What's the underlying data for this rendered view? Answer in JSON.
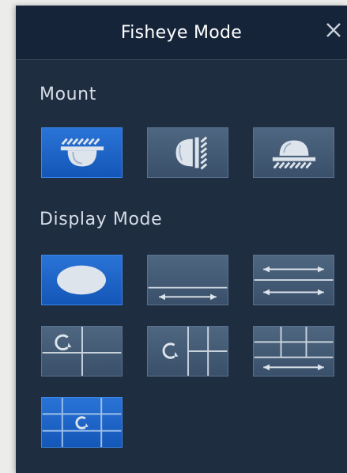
{
  "dialog": {
    "title": "Fisheye Mode",
    "close_icon": "close-icon"
  },
  "mount": {
    "label": "Mount",
    "options": [
      {
        "name": "ceiling-mount",
        "icon": "ceiling-mount-icon",
        "selected": true
      },
      {
        "name": "wall-mount",
        "icon": "wall-mount-icon",
        "selected": false
      },
      {
        "name": "desktop-mount",
        "icon": "desktop-mount-icon",
        "selected": false
      }
    ]
  },
  "display_mode": {
    "label": "Display Mode",
    "options": [
      {
        "name": "fisheye-original",
        "icon": "fisheye-circle-icon",
        "selected": true
      },
      {
        "name": "panorama-360",
        "icon": "panorama-icon",
        "selected": false
      },
      {
        "name": "double-panorama",
        "icon": "double-panorama-icon",
        "selected": false
      },
      {
        "name": "fisheye-3-ptz",
        "icon": "fisheye-3ptz-icon",
        "selected": false
      },
      {
        "name": "fisheye-8-ptz",
        "icon": "fisheye-8ptz-icon",
        "selected": false
      },
      {
        "name": "panorama-6-ptz",
        "icon": "panorama-6ptz-icon",
        "selected": false
      },
      {
        "name": "fisheye-8-ptz-grid",
        "icon": "fisheye-grid-icon",
        "selected": false
      }
    ]
  },
  "colors": {
    "panel_bg": "#1f2d40",
    "titlebar_bg": "#16243a",
    "selected_bg": "#1e64c8",
    "button_bg": "#435a74",
    "icon_fill": "#dde4ec"
  }
}
